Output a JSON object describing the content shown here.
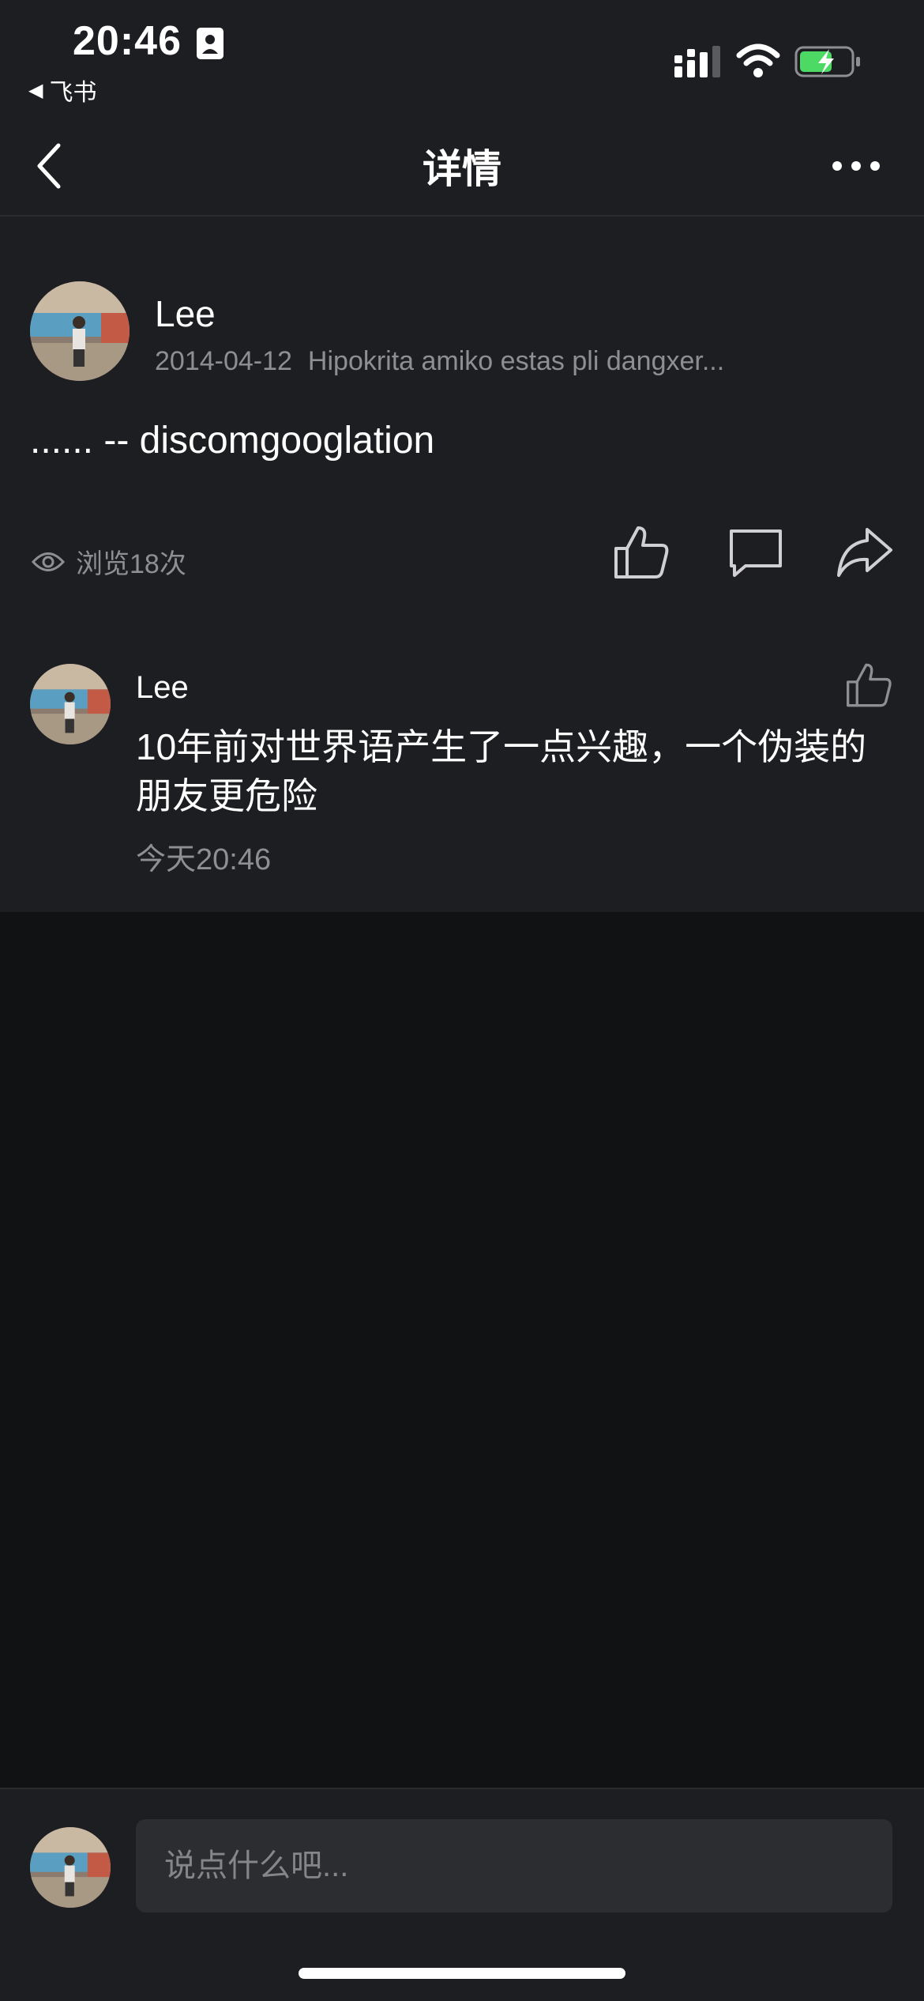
{
  "status_bar": {
    "time": "20:46",
    "back_app": "飞书",
    "battery_color": "#4cd964"
  },
  "nav": {
    "title": "详情"
  },
  "post": {
    "author": "Lee",
    "date": "2014-04-12",
    "source": "Hipokrita amiko estas pli dangxer...",
    "body": "...... -- discomgooglation",
    "views": "浏览18次"
  },
  "comment": {
    "author": "Lee",
    "text": "10年前对世界语产生了一点兴趣，一个伪装的朋友更危险",
    "time": "今天20:46"
  },
  "composer": {
    "placeholder": "说点什么吧..."
  },
  "icons": [
    "contact-card-icon",
    "signal-icon",
    "wifi-icon",
    "battery-charging-icon",
    "back-chevron-icon",
    "more-icon",
    "eye-icon",
    "like-icon",
    "comment-icon",
    "share-icon"
  ]
}
